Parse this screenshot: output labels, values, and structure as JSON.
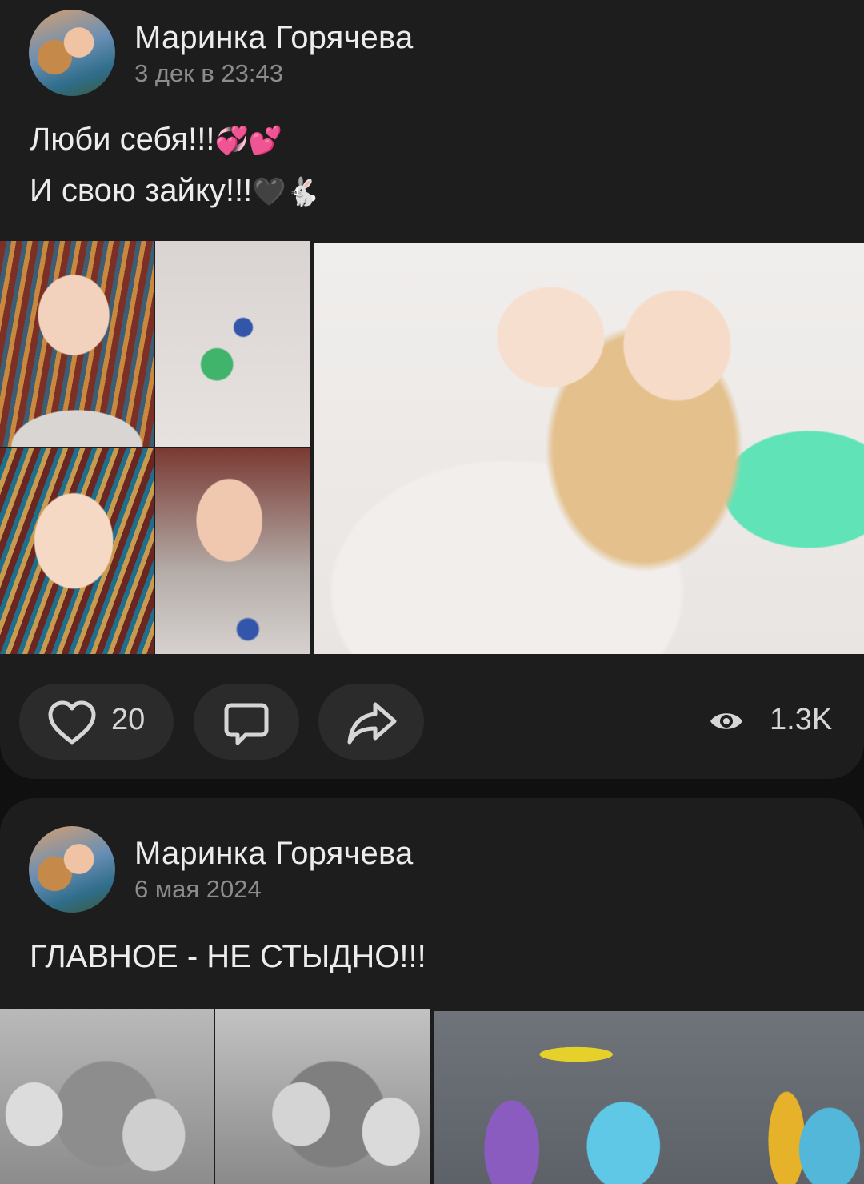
{
  "posts": [
    {
      "author": "Маринка Горячева",
      "date": "3 дек в 23:43",
      "text_lines": [
        "Люби себя!!!",
        "И свою зайку!!!"
      ],
      "emoji_line1": "💞💕",
      "emoji_line2": "🖤🐇",
      "likes": "20",
      "views": "1.3K"
    },
    {
      "author": "Маринка Горячева",
      "date": "6 мая 2024",
      "text_lines": [
        "ГЛАВНОЕ - НЕ СТЫДНО!!!"
      ]
    }
  ],
  "icons": {
    "like": "heart-icon",
    "comment": "comment-icon",
    "share": "share-icon",
    "views": "eye-icon"
  },
  "colors": {
    "background": "#101010",
    "card": "#1d1d1d",
    "pill": "#2b2b2b",
    "secondary_text": "#8c8c8c"
  }
}
